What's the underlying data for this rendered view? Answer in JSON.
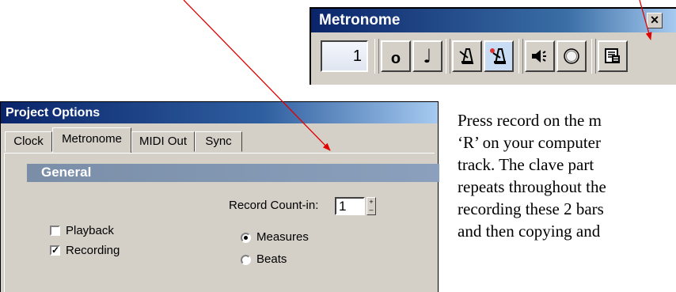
{
  "metronome": {
    "title": "Metronome",
    "close": "✕",
    "count_value": "1",
    "buttons": [
      {
        "name": "whole-note-icon",
        "glyph": "o"
      },
      {
        "name": "quarter-note-icon",
        "glyph": "♩"
      },
      {
        "name": "metronome-playback-icon"
      },
      {
        "name": "metronome-record-icon"
      },
      {
        "name": "speaker-icon"
      },
      {
        "name": "circle-icon"
      },
      {
        "name": "metronome-options-icon"
      }
    ]
  },
  "dialog": {
    "title": "Project Options",
    "tabs": [
      "Clock",
      "Metronome",
      "MIDI Out",
      "Sync"
    ],
    "section": "General",
    "record_count_in_label": "Record Count-in:",
    "record_count_in_value": "1",
    "playback_label": "Playback",
    "recording_label": "Recording",
    "measures_label": "Measures",
    "beats_label": "Beats",
    "playback_checked": false,
    "recording_checked": true,
    "count_in_unit": "Measures"
  },
  "text": {
    "lines": [
      "Press record on the m",
      "‘R’ on your computer",
      "track.  The clave part",
      "repeats throughout the",
      "recording these 2 bars",
      "and then copying and"
    ]
  },
  "colors": {
    "arrow": "#e00000",
    "titlebar": "#0a246a",
    "face": "#d4d0c8"
  }
}
